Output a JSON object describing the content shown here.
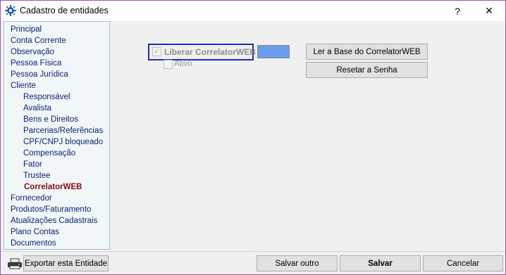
{
  "window": {
    "title": "Cadastro de entidades"
  },
  "titlebar": {
    "help_label": "?",
    "close_label": "✕"
  },
  "nav": {
    "items": [
      {
        "label": "Principal"
      },
      {
        "label": "Conta Corrente"
      },
      {
        "label": "Observação"
      },
      {
        "label": "Pessoa Física"
      },
      {
        "label": "Pessoa Jurídica"
      },
      {
        "label": "Cliente"
      },
      {
        "label": "Responsável"
      },
      {
        "label": "Avalista"
      },
      {
        "label": "Bens e Direitos"
      },
      {
        "label": "Parcerias/Referências"
      },
      {
        "label": "CPF/CNPJ bloqueado"
      },
      {
        "label": "Compensação"
      },
      {
        "label": "Fator"
      },
      {
        "label": "Trustee"
      },
      {
        "label": "CorrelatorWEB"
      },
      {
        "label": "Fornecedor"
      },
      {
        "label": "Produtos/Faturamento"
      },
      {
        "label": "Atualizações Cadastrais"
      },
      {
        "label": "Plano Contas"
      },
      {
        "label": "Documentos"
      }
    ],
    "active": "CorrelatorWEB"
  },
  "form": {
    "liberar_label": "Liberar CorrelatorWEB",
    "liberar_checked": true,
    "ativo_label": "Ativo",
    "ativo_checked": false,
    "swatch_color": "#6a9eed",
    "ler_base_label": "Ler a Base do CorrelatorWEB",
    "resetar_label": "Resetar a Senha"
  },
  "footer": {
    "export_label": "Exportar esta Entidade",
    "salvar_outro_label": "Salvar outro",
    "salvar_label": "Salvar",
    "cancelar_label": "Cancelar"
  },
  "icons": {
    "app": "app-gear-icon",
    "printer": "printer-icon",
    "help": "help-icon",
    "close": "close-icon"
  }
}
